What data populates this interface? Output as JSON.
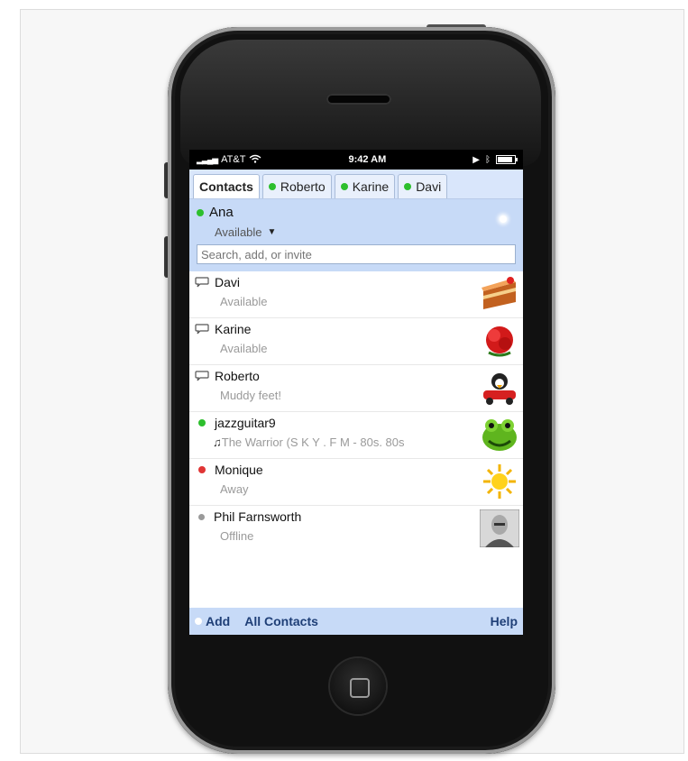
{
  "status_bar": {
    "carrier": "AT&T",
    "time": "9:42 AM"
  },
  "tabs": [
    {
      "label": "Contacts"
    },
    {
      "label": "Roberto"
    },
    {
      "label": "Karine"
    },
    {
      "label": "Davi"
    }
  ],
  "me": {
    "name": "Ana",
    "status": "Available",
    "status_caret": "▼"
  },
  "search": {
    "placeholder": "Search, add, or invite"
  },
  "contacts": [
    {
      "name": "Davi",
      "status": "Available",
      "presence": "chat",
      "avatar": "cake"
    },
    {
      "name": "Karine",
      "status": "Available",
      "presence": "chat",
      "avatar": "red-rose"
    },
    {
      "name": "Roberto",
      "status": "Muddy feet!",
      "presence": "chat",
      "avatar": "penguin-car"
    },
    {
      "name": "jazzguitar9",
      "status": "The Warrior (S K Y . F M - 80s. 80s",
      "presence": "online",
      "avatar": "frog"
    },
    {
      "name": "Monique",
      "status": "Away",
      "presence": "away",
      "avatar": "sun"
    },
    {
      "name": "Phil Farnsworth",
      "status": "Offline",
      "presence": "offline",
      "avatar": "photo"
    }
  ],
  "bottom": {
    "add": "Add",
    "all_contacts": "All Contacts",
    "help": "Help"
  },
  "colors": {
    "accent_bg": "#c7daf7",
    "online": "#2dbf2d",
    "away": "#e03535",
    "offline": "#9a9a9a",
    "link": "#1f3f77"
  }
}
